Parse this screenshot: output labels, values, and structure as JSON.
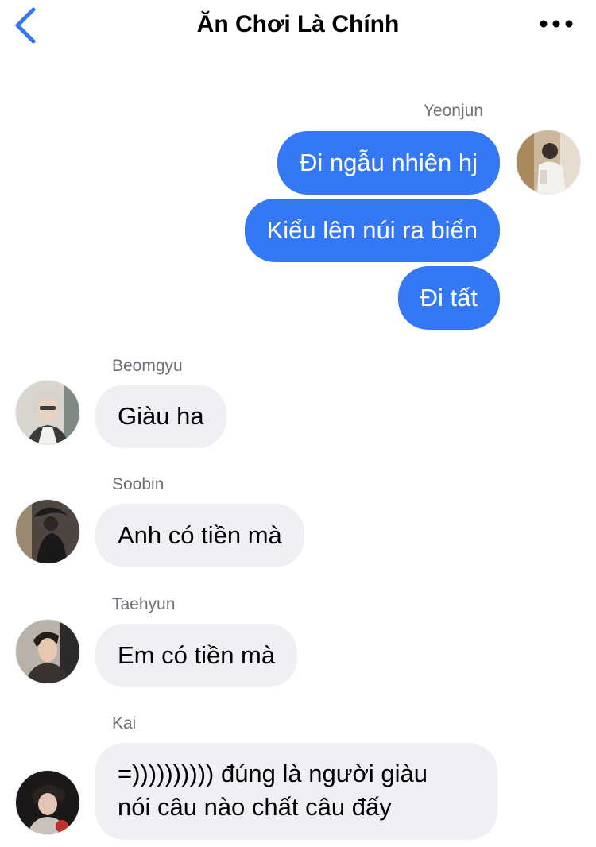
{
  "header": {
    "title": "Ăn Chơi Là Chính",
    "back_icon": "chevron-left-icon",
    "more_icon": "ellipsis-icon"
  },
  "colors": {
    "accent": "#3478f6",
    "incoming_bubble": "#f0f0f4",
    "sender_name": "#707078"
  },
  "messages": {
    "yeonjun": {
      "sender": "Yeonjun",
      "lines": [
        "Đi ngẫu nhiên hj",
        "Kiểu lên núi ra biển",
        "Đi tất"
      ]
    },
    "beomgyu": {
      "sender": "Beomgyu",
      "text": "Giàu ha"
    },
    "soobin": {
      "sender": "Soobin",
      "text": "Anh có tiền mà"
    },
    "taehyun": {
      "sender": "Taehyun",
      "text": "Em có tiền mà"
    },
    "kai": {
      "sender": "Kai",
      "line1": "=)))))))))) đúng là người giàu",
      "line2": "nói câu nào chất câu đấy"
    }
  }
}
